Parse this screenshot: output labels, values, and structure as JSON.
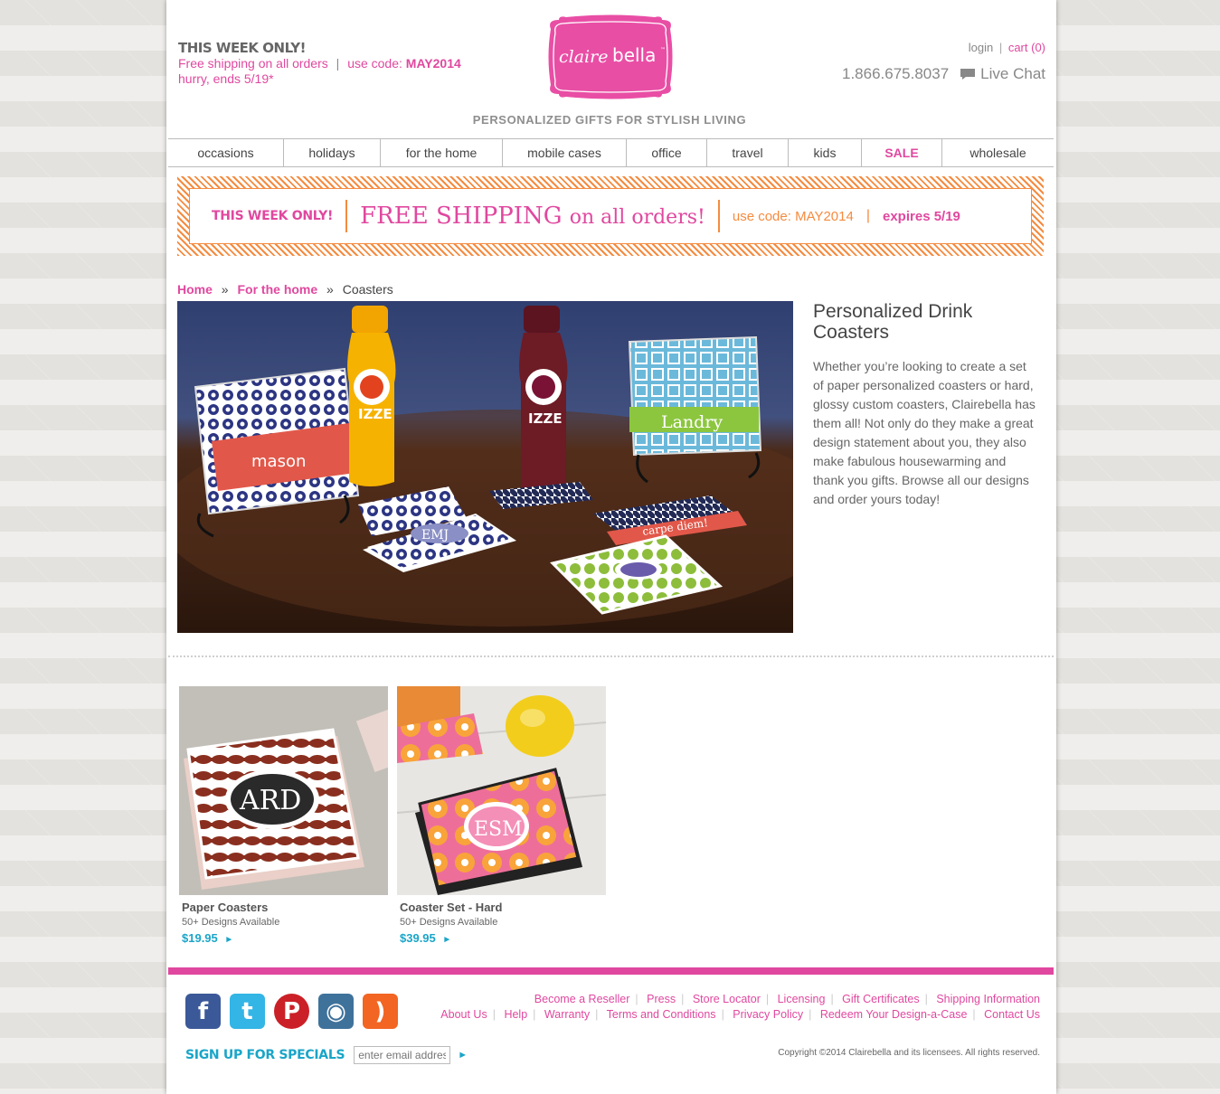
{
  "promo": {
    "heading": "THIS WEEK ONLY!",
    "line1": "Free shipping on all orders",
    "sep": "|",
    "code_prefix": "use code:",
    "code": "MAY2014",
    "line2": "hurry, ends 5/19*"
  },
  "logo": {
    "text_left": "claire",
    "text_right": "bella",
    "tm": "™"
  },
  "tagline": "PERSONALIZED GIFTS FOR STYLISH LIVING",
  "util": {
    "login": "login",
    "divider": "|",
    "cart": "cart (0)"
  },
  "contact": {
    "phone": "1.866.675.8037",
    "chat": "Live Chat"
  },
  "nav": [
    {
      "label": "occasions"
    },
    {
      "label": "holidays"
    },
    {
      "label": "for the home"
    },
    {
      "label": "mobile cases"
    },
    {
      "label": "office"
    },
    {
      "label": "travel"
    },
    {
      "label": "kids"
    },
    {
      "label": "SALE"
    },
    {
      "label": "wholesale"
    }
  ],
  "banner": {
    "week": "THIS WEEK ONLY!",
    "free": "FREE SHIPPING",
    "on": "on all orders!",
    "code_prefix": "use code:",
    "code": "MAY2014",
    "sep": "|",
    "expires": "expires 5/19"
  },
  "breadcrumb": {
    "home": "Home",
    "sep": "»",
    "section": "For the home",
    "current": "Coasters"
  },
  "hero": {
    "labels": [
      "mason",
      "IZZE",
      "IZZE",
      "Landry",
      "EMJ",
      "carpe diem!"
    ]
  },
  "intro": {
    "title": "Personalized Drink Coasters",
    "text": "Whether you’re looking to create a set of paper personalized coasters or hard, glossy custom coasters, Clairebella has them all! Not only do they make a great design statement about you, they also make fabulous housewarming and thank you gifts. Browse all our designs and order yours today!"
  },
  "products": [
    {
      "name": "Paper Coasters",
      "sub": "50+ Designs Available",
      "price": "$19.95",
      "arrow": "►",
      "monogram": "ARD"
    },
    {
      "name": "Coaster Set - Hard",
      "sub": "50+ Designs Available",
      "price": "$39.95",
      "arrow": "►",
      "monogram": "ESM"
    }
  ],
  "social": [
    {
      "icon": "facebook-icon",
      "glyph": "f",
      "color": "#3b5998"
    },
    {
      "icon": "twitter-icon",
      "glyph": "t",
      "color": "#33b5e5"
    },
    {
      "icon": "pinterest-icon",
      "glyph": "P",
      "color": "#cb2027"
    },
    {
      "icon": "instagram-icon",
      "glyph": "◉",
      "color": "#3f729b"
    },
    {
      "icon": "rss-icon",
      "glyph": ")",
      "color": "#f26522"
    }
  ],
  "signup": {
    "label": "SIGN UP FOR SPECIALS",
    "placeholder": "enter email address",
    "go": "►"
  },
  "footer": {
    "links_row1": [
      "Become a Reseller",
      "Press",
      "Store Locator",
      "Licensing",
      "Gift Certificates",
      "Shipping Information"
    ],
    "links_row2": [
      "About Us",
      "Help",
      "Warranty",
      "Terms and Conditions",
      "Privacy Policy",
      "Redeem Your Design-a-Case",
      "Contact Us"
    ],
    "copyright": "Copyright ©2014 Clairebella and its licensees. All rights reserved."
  },
  "colors": {
    "brand_pink": "#e0489f",
    "accent_orange": "#f58b3f",
    "accent_blue": "#1aa5c8"
  }
}
